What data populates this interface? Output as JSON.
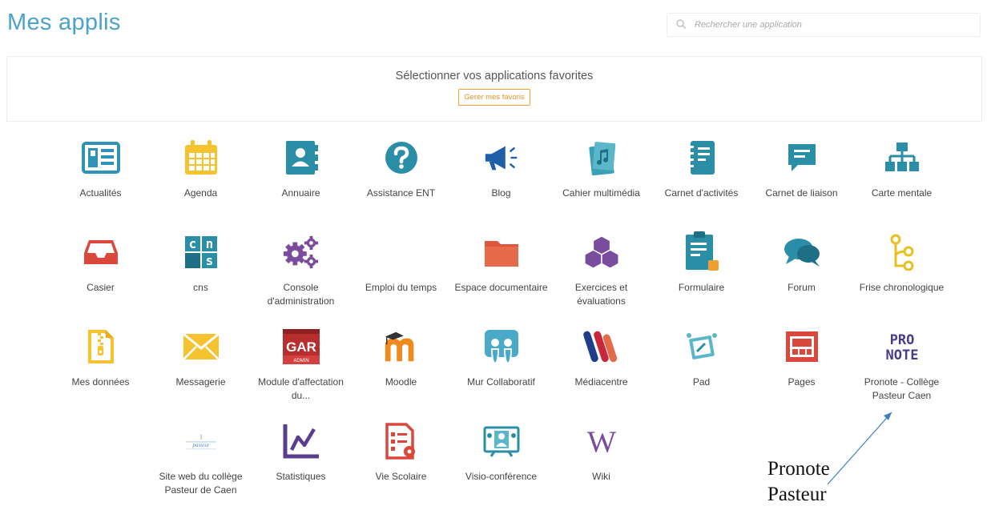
{
  "header": {
    "title": "Mes applis",
    "search_placeholder": "Rechercher une application"
  },
  "favorites": {
    "prompt": "Sélectionner vos applications favorites",
    "button_label": "Gerer mes favoris"
  },
  "apps": [
    {
      "label": "Actualités",
      "icon": "newspaper-icon"
    },
    {
      "label": "Agenda",
      "icon": "calendar-icon"
    },
    {
      "label": "Annuaire",
      "icon": "address-book-icon"
    },
    {
      "label": "Assistance ENT",
      "icon": "question-icon"
    },
    {
      "label": "Blog",
      "icon": "megaphone-icon"
    },
    {
      "label": "Cahier multimédia",
      "icon": "multimedia-notebook-icon"
    },
    {
      "label": "Carnet d'activités",
      "icon": "activity-notebook-icon"
    },
    {
      "label": "Carnet de liaison",
      "icon": "message-icon"
    },
    {
      "label": "Carte mentale",
      "icon": "sitemap-icon"
    },
    {
      "label": "Casier",
      "icon": "inbox-tray-icon"
    },
    {
      "label": "cns",
      "icon": "cns-icon"
    },
    {
      "label": "Console d'administration",
      "icon": "gears-icon"
    },
    {
      "label": "Emploi du temps",
      "icon": ""
    },
    {
      "label": "Espace documentaire",
      "icon": "folder-icon"
    },
    {
      "label": "Exercices et évaluations",
      "icon": "cubes-icon"
    },
    {
      "label": "Formulaire",
      "icon": "form-icon"
    },
    {
      "label": "Forum",
      "icon": "chat-bubbles-icon"
    },
    {
      "label": "Frise chronologique",
      "icon": "timeline-icon"
    },
    {
      "label": "Mes données",
      "icon": "zip-file-icon"
    },
    {
      "label": "Messagerie",
      "icon": "envelope-icon"
    },
    {
      "label": "Module d'affectation du...",
      "icon": "gar-icon",
      "icon_text": "GAR",
      "icon_subtext": "ADMIN"
    },
    {
      "label": "Moodle",
      "icon": "moodle-icon"
    },
    {
      "label": "Mur Collaboratif",
      "icon": "collaborative-wall-icon"
    },
    {
      "label": "Médiacentre",
      "icon": "mediacentre-icon"
    },
    {
      "label": "Pad",
      "icon": "pad-icon"
    },
    {
      "label": "Pages",
      "icon": "pages-icon"
    },
    {
      "label": "Pronote - Collège Pasteur Caen",
      "icon": "pronote-icon",
      "icon_text": "PRO NOTE"
    },
    {
      "label": "",
      "icon": ""
    },
    {
      "label": "Site web du collège Pasteur de Caen",
      "icon": "college-website-icon"
    },
    {
      "label": "Statistiques",
      "icon": "statistics-icon"
    },
    {
      "label": "Vie Scolaire",
      "icon": "school-life-icon"
    },
    {
      "label": "Visio-conférence",
      "icon": "video-conference-icon"
    },
    {
      "label": "Wiki",
      "icon": "wiki-icon",
      "icon_text": "W"
    }
  ],
  "annotation": {
    "line1": "Pronote",
    "line2": "Pasteur"
  },
  "colors": {
    "title": "#4aa3c9",
    "accent_orange": "#e8912a",
    "blue": "#4aa3c9",
    "teal": "#2a8fa0",
    "purple": "#7a4c9e",
    "red": "#e05a3b",
    "yellow": "#f2c230"
  }
}
